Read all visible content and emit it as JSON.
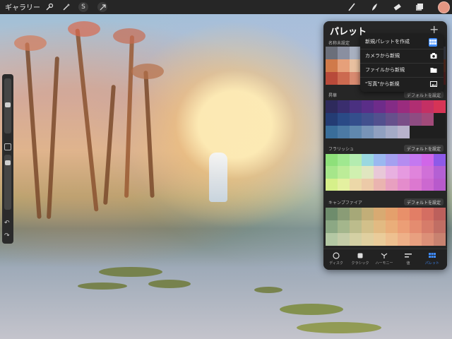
{
  "topbar": {
    "gallery_label": "ギャラリー",
    "tools_left": [
      "wrench-icon",
      "magic-wand-icon",
      "selection-icon",
      "transform-arrow-icon"
    ],
    "tools_right": [
      "brush-icon",
      "smudge-icon",
      "eraser-icon",
      "layers-icon"
    ],
    "current_color": "#e49682"
  },
  "palette": {
    "title": "パレット",
    "add_symbol": "+",
    "sections": [
      {
        "name": "名称未設定",
        "cols": 10,
        "rows": 3,
        "colors": [
          "#6b6f7a",
          "#8a8fa0",
          "#a8b0c0",
          "#c5cad5",
          "#d8dbe3",
          "#9aa0b0",
          "#7f8595",
          "#5e6272",
          "#4a4d5a",
          "#3b3e48",
          "#d07a4a",
          "#e6a07a",
          "#e8c0a0",
          "#f2d8c0",
          "#f5e6d8",
          "#c9906c",
          "#b06848",
          "#904e36",
          "#743c2a",
          "#5a2e22",
          "#b84a3a",
          "#cc6a50",
          "#d88a70",
          "#e2a890",
          "#e8c0a8",
          "#b46a5a",
          "#9c5448",
          "#823e36",
          "#6c2e2a",
          "#542222"
        ]
      },
      {
        "name": "昇華",
        "default_label": "デフォルトを設定",
        "cols": 10,
        "rows": 3,
        "colors": [
          "#2e2a5c",
          "#3a2e6e",
          "#4a3080",
          "#5a2e88",
          "#6e2c8a",
          "#842c86",
          "#9a2c7e",
          "#b02e72",
          "#c43064",
          "#d63456",
          "#243c74",
          "#2a4a86",
          "#344e8c",
          "#42508e",
          "#52508e",
          "#66508c",
          "#7a4e88",
          "#8e4c82",
          "#a24a7a",
          "#1f1f1f",
          "#3a6e9a",
          "#4c7aa4",
          "#6088ae",
          "#7894b8",
          "#90a0c0",
          "#a4aac6",
          "#b8b2cc",
          "#1f1f1f",
          "#1f1f1f",
          "#1f1f1f"
        ]
      },
      {
        "name": "フラリッシュ",
        "default_label": "デフォルトを設定",
        "cols": 10,
        "rows": 3,
        "colors": [
          "#8ee07a",
          "#a0e890",
          "#b4ecb0",
          "#9ad8e0",
          "#9ab8f0",
          "#a4a0f0",
          "#b48cf0",
          "#c478f0",
          "#d066e8",
          "#8e5ae8",
          "#a6e68a",
          "#bcec98",
          "#d0f0b0",
          "#e0e6c0",
          "#e8c8d8",
          "#e8b0e0",
          "#e69ae0",
          "#e084dc",
          "#d070d8",
          "#b460d4",
          "#d6f08a",
          "#e4f0a0",
          "#ecd8a8",
          "#eccaa8",
          "#eab4b0",
          "#e8a0c0",
          "#e48ccc",
          "#dc78d0",
          "#cc68d0",
          "#b85acc"
        ]
      },
      {
        "name": "キャンプファイア",
        "default_label": "デフォルトを設定",
        "cols": 10,
        "rows": 3,
        "colors": [
          "#6e8c6c",
          "#8a9c76",
          "#a6a878",
          "#c2ae78",
          "#d8aa72",
          "#e4a06c",
          "#e8906a",
          "#e27e66",
          "#d46e62",
          "#bc605c",
          "#8ca884",
          "#a4b68c",
          "#bcbc8c",
          "#d2c08a",
          "#e2ba82",
          "#eaae7a",
          "#ec9e76",
          "#e48c70",
          "#d67c6a",
          "#c06e64",
          "#b4c8a4",
          "#c4cca8",
          "#d4d0a4",
          "#e0d0a0",
          "#eacc9a",
          "#eec090",
          "#eeb088",
          "#e8a080",
          "#dc9078",
          "#c88270"
        ]
      }
    ],
    "menu": [
      {
        "label": "新規パレットを作成",
        "icon": "grid-icon",
        "highlight": true
      },
      {
        "label": "カメラから新規",
        "icon": "camera-icon"
      },
      {
        "label": "ファイルから新規",
        "icon": "folder-icon"
      },
      {
        "label": "\"写真\"から新規",
        "icon": "photo-icon"
      }
    ],
    "tabs": [
      {
        "label": "ディスク",
        "icon": "disc-icon"
      },
      {
        "label": "クラシック",
        "icon": "classic-icon"
      },
      {
        "label": "ハーモニー",
        "icon": "harmony-icon"
      },
      {
        "label": "値",
        "icon": "value-icon"
      },
      {
        "label": "パレット",
        "icon": "palette-grid-icon",
        "active": true
      }
    ]
  }
}
